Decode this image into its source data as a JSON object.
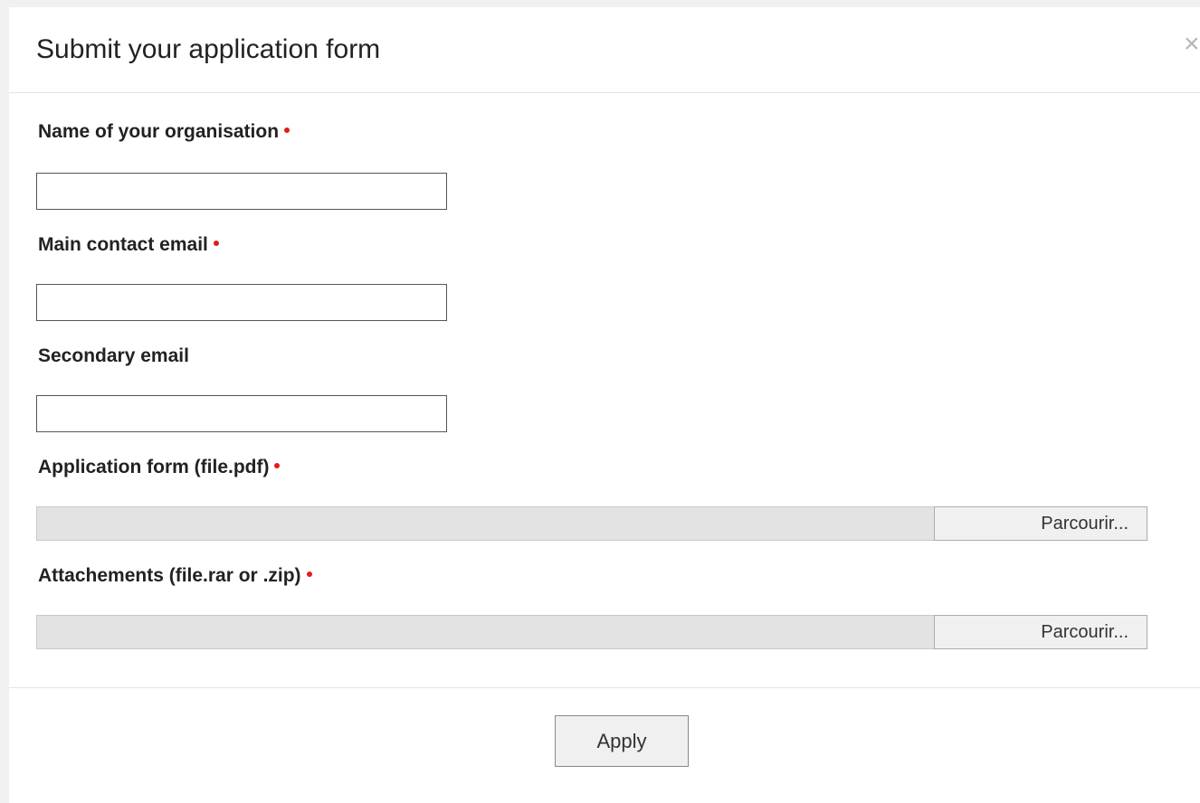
{
  "modal": {
    "title": "Submit your application form",
    "close_symbol": "×"
  },
  "fields": {
    "organisation": {
      "label": "Name of your organisation",
      "required": true,
      "value": ""
    },
    "main_email": {
      "label": "Main contact email",
      "required": true,
      "value": ""
    },
    "secondary_email": {
      "label": "Secondary email",
      "required": false,
      "value": ""
    },
    "application_file": {
      "label": "Application form (file.pdf)",
      "required": true,
      "browse_label": "Parcourir..."
    },
    "attachments_file": {
      "label": "Attachements (file.rar or .zip)",
      "required": true,
      "browse_label": "Parcourir..."
    }
  },
  "footer": {
    "apply_label": "Apply"
  },
  "colors": {
    "required_marker": "#e01b1b",
    "file_path_bg": "#e3e3e3"
  },
  "icons": {
    "close": "close-icon",
    "required": "required-dot-icon"
  }
}
